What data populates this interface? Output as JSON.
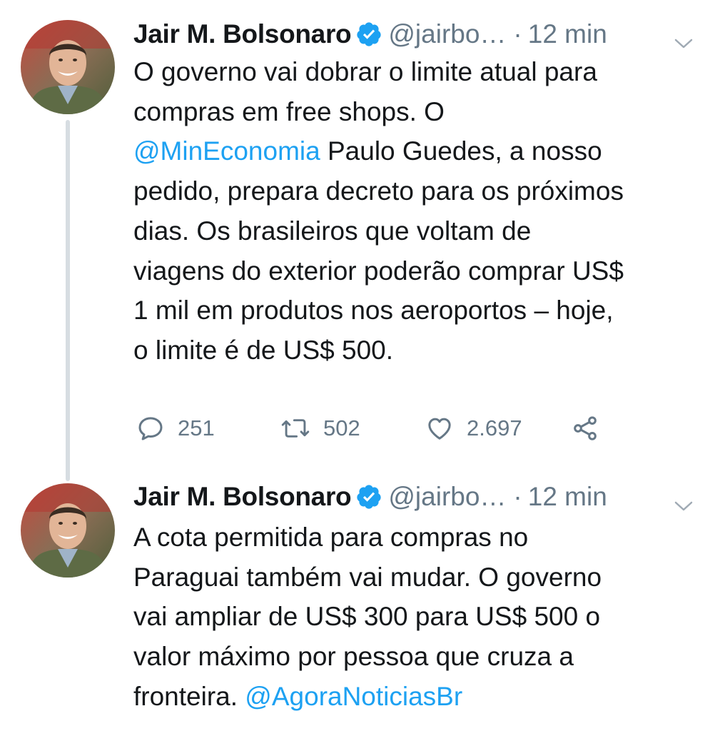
{
  "tweets": [
    {
      "author": {
        "name": "Jair M. Bolsonaro",
        "handle": "@jairbo…",
        "verified": true,
        "avatar_icon": "profile-photo"
      },
      "separator": "·",
      "time": "12 min",
      "text_lines": [
        [
          {
            "t": "O governo vai dobrar o limite atual para"
          }
        ],
        [
          {
            "t": "compras em free shops. O"
          }
        ],
        [
          {
            "t": "@MinEconomia",
            "mention": true
          },
          {
            "t": " Paulo Guedes, a nosso"
          }
        ],
        [
          {
            "t": "pedido, prepara decreto para os próximos"
          }
        ],
        [
          {
            "t": "dias. Os brasileiros que voltam de"
          }
        ],
        [
          {
            "t": "viagens do exterior poderão comprar US$"
          }
        ],
        [
          {
            "t": "1 mil em produtos nos aeroportos – hoje,"
          }
        ],
        [
          {
            "t": "o limite é de US$ 500."
          }
        ]
      ],
      "actions": {
        "reply_count": "251",
        "retweet_count": "502",
        "like_count": "2.697"
      }
    },
    {
      "author": {
        "name": "Jair M. Bolsonaro",
        "handle": "@jairbo…",
        "verified": true,
        "avatar_icon": "profile-photo"
      },
      "separator": "·",
      "time": "12 min",
      "text_lines": [
        [
          {
            "t": "A cota permitida para compras no"
          }
        ],
        [
          {
            "t": "Paraguai também vai mudar. O governo"
          }
        ],
        [
          {
            "t": "vai ampliar de US$ 300 para US$ 500 o"
          }
        ],
        [
          {
            "t": "valor máximo por pessoa que cruza a"
          }
        ],
        [
          {
            "t": "fronteira. "
          },
          {
            "t": "@AgoraNoticiasBr",
            "mention": true
          }
        ]
      ]
    }
  ],
  "colors": {
    "text": "#14171a",
    "secondary": "#657786",
    "link": "#1da1f2",
    "verified": "#1da1f2",
    "thread_line": "#d7dde2"
  },
  "icons": [
    "verified-badge-icon",
    "chevron-down-icon",
    "reply-icon",
    "retweet-icon",
    "like-icon",
    "share-icon"
  ]
}
